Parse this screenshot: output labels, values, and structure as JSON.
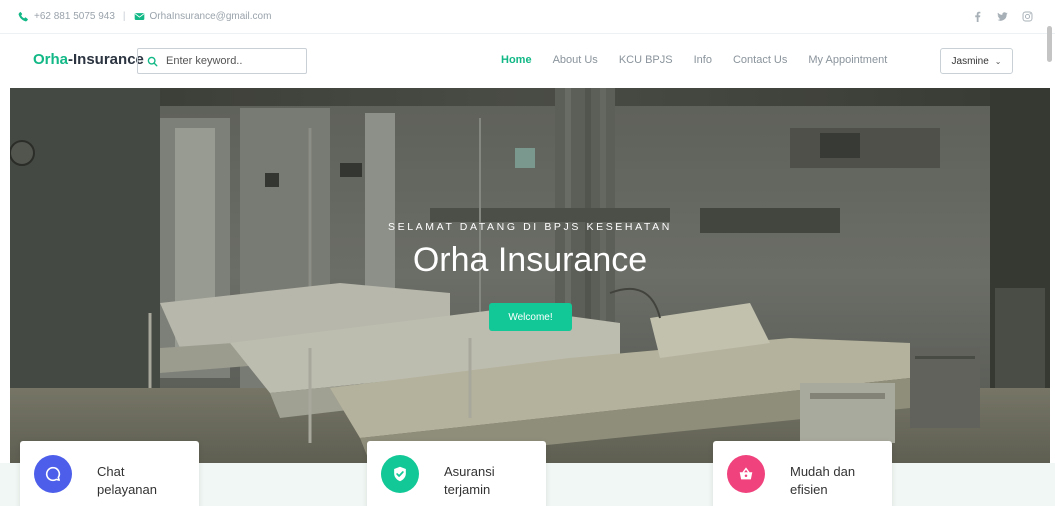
{
  "topbar": {
    "phone": "+62 881 5075 943",
    "separator": "|",
    "email": "OrhaInsurance@gmail.com"
  },
  "navbar": {
    "brand_accent": "Orha",
    "brand_rest": "-Insurance",
    "search_placeholder": "Enter keyword..",
    "items": [
      "Home",
      "About Us",
      "KCU BPJS",
      "Info",
      "Contact Us",
      "My Appointment"
    ],
    "active_item": "Home",
    "user_name": "Jasmine"
  },
  "hero": {
    "kicker": "SELAMAT DATANG DI BPJS KESEHATAN",
    "title": "Orha Insurance",
    "button_label": "Welcome!"
  },
  "features": [
    {
      "line1": "Chat",
      "line2": "pelayanan",
      "icon": "chat-bubble-icon",
      "color": "#4c5eea"
    },
    {
      "line1": "Asuransi",
      "line2": "terjamin",
      "icon": "shield-check-icon",
      "color": "#12c896"
    },
    {
      "line1": "Mudah dan",
      "line2": "efisien",
      "icon": "basket-icon",
      "color": "#f0437e"
    }
  ],
  "colors": {
    "accent": "#12b886",
    "button": "#12c896",
    "text_dark": "#2b3440",
    "text_muted": "#8a949c"
  },
  "social_icons": [
    "facebook-icon",
    "twitter-icon",
    "instagram-icon"
  ]
}
